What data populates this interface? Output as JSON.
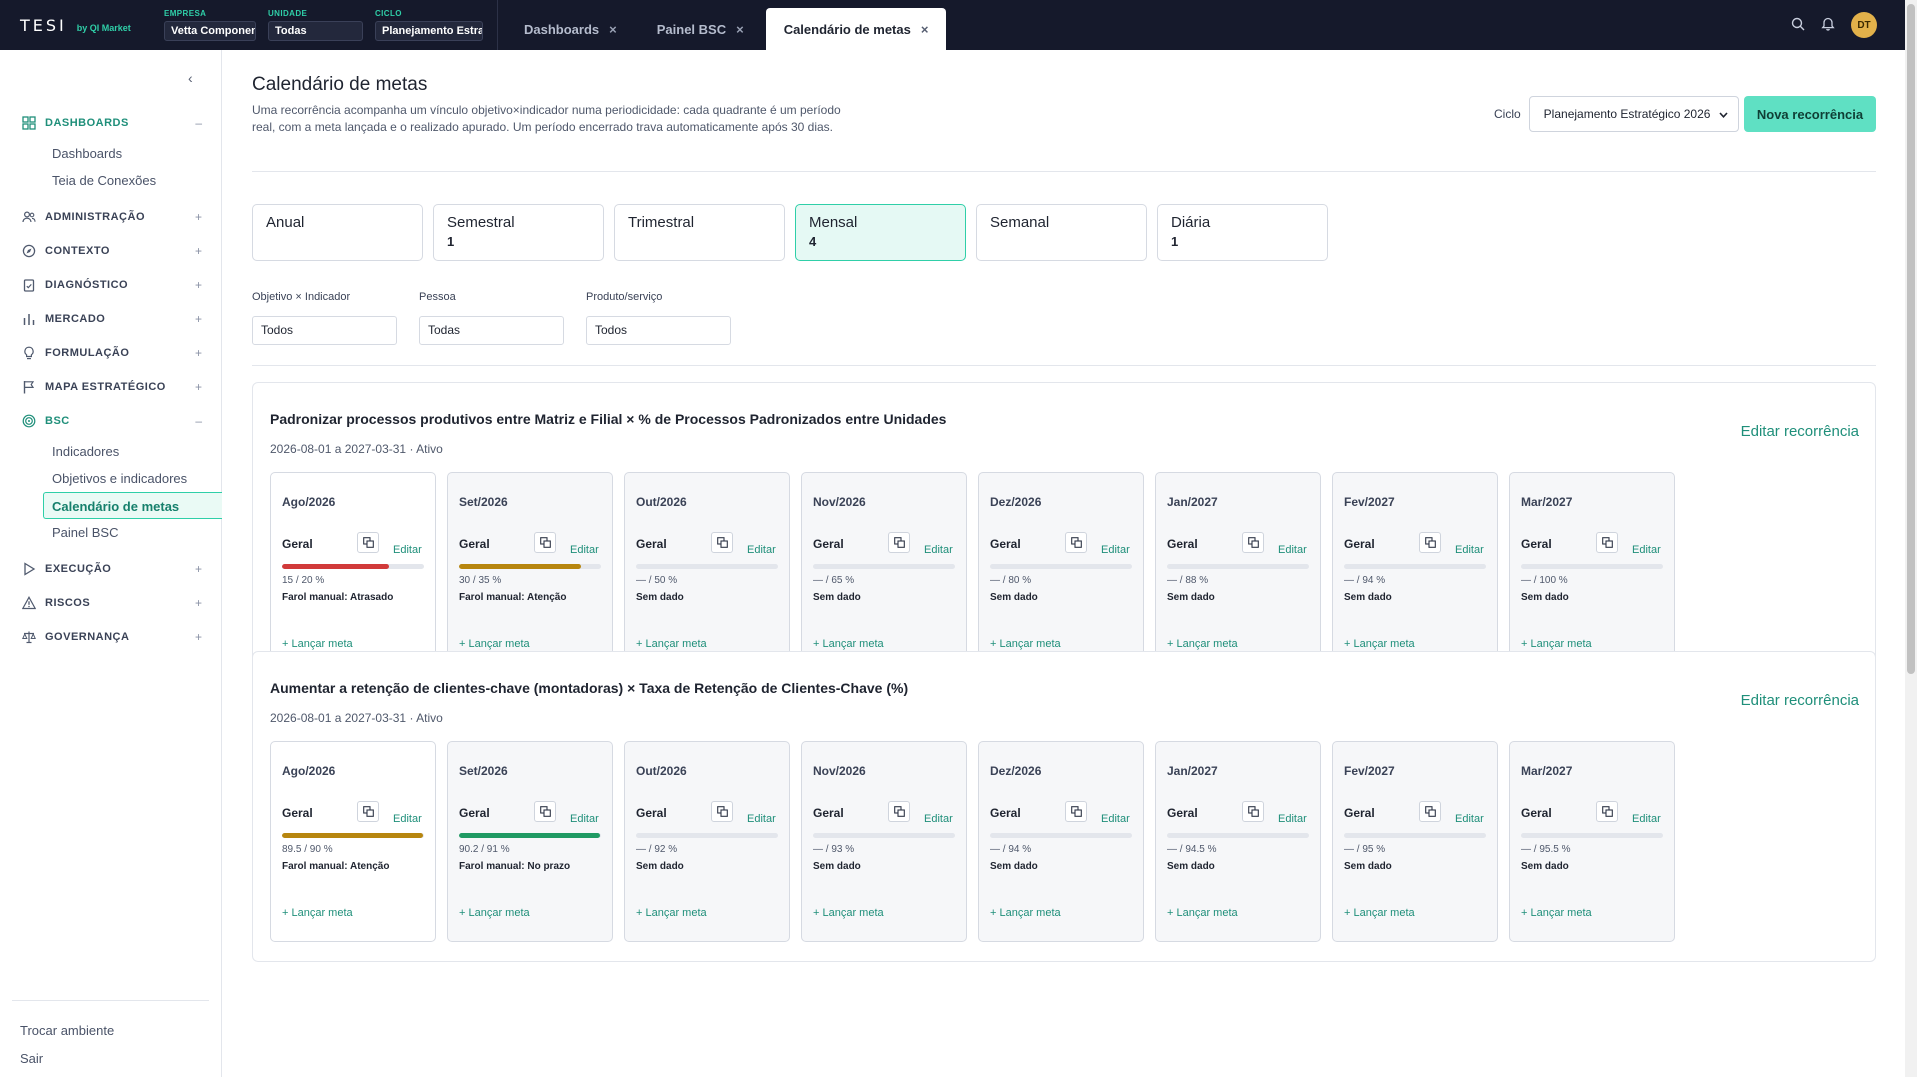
{
  "app": {
    "logo_text": "TESI",
    "logo_by": "by QI Market",
    "context": [
      {
        "label": "EMPRESA",
        "value": "Vetta Componentes"
      },
      {
        "label": "UNIDADE",
        "value": "Todas"
      },
      {
        "label": "CICLO",
        "value": "Planejamento Estratégi"
      }
    ],
    "tabs": [
      {
        "label": "Dashboards",
        "active": false
      },
      {
        "label": "Painel BSC",
        "active": false
      },
      {
        "label": "Calendário de metas",
        "active": true
      }
    ],
    "close_glyph": "×",
    "user_initials": "DT"
  },
  "sidebar": {
    "collapse_glyph": "‹",
    "sections": [
      {
        "title": "DASHBOARDS",
        "icon": "dashboard-icon",
        "open": true,
        "toggle": "–",
        "items": [
          "Dashboards",
          "Teia de Conexões"
        ]
      },
      {
        "title": "ADMINISTRAÇÃO",
        "icon": "users-icon",
        "open": false,
        "toggle": "+"
      },
      {
        "title": "CONTEXTO",
        "icon": "compass-icon",
        "open": false,
        "toggle": "+"
      },
      {
        "title": "DIAGNÓSTICO",
        "icon": "clipboard-icon",
        "open": false,
        "toggle": "+"
      },
      {
        "title": "MERCADO",
        "icon": "bar-chart-icon",
        "open": false,
        "toggle": "+"
      },
      {
        "title": "FORMULAÇÃO",
        "icon": "lightbulb-icon",
        "open": false,
        "toggle": "+"
      },
      {
        "title": "MAPA ESTRATÉGICO",
        "icon": "flag-icon",
        "open": false,
        "toggle": "+"
      },
      {
        "title": "BSC",
        "icon": "target-icon",
        "open": true,
        "toggle": "–",
        "items": [
          "Indicadores",
          "Objetivos e indicadores",
          "Calendário de metas",
          "Painel BSC"
        ],
        "active_item": "Calendário de metas"
      },
      {
        "title": "EXECUÇÃO",
        "icon": "play-icon",
        "open": false,
        "toggle": "+"
      },
      {
        "title": "RISCOS",
        "icon": "warning-icon",
        "open": false,
        "toggle": "+"
      },
      {
        "title": "GOVERNANÇA",
        "icon": "scale-icon",
        "open": false,
        "toggle": "+"
      }
    ],
    "bottom": [
      "Trocar ambiente",
      "Sair"
    ]
  },
  "page": {
    "title": "Calendário de metas",
    "description": "Uma recorrência acompanha um vínculo objetivo×indicador numa periodicidade: cada quadrante é um período real, com a meta lançada e o realizado apurado. Um período encerrado trava automaticamente após 30 dias.",
    "cycle_label": "Ciclo",
    "cycle_value": "Planejamento Estratégico 2026",
    "new_button": "Nova recorrência",
    "periods": [
      {
        "name": "Anual",
        "count": ""
      },
      {
        "name": "Semestral",
        "count": "1"
      },
      {
        "name": "Trimestral",
        "count": ""
      },
      {
        "name": "Mensal",
        "count": "4",
        "active": true
      },
      {
        "name": "Semanal",
        "count": ""
      },
      {
        "name": "Diária",
        "count": "1"
      }
    ],
    "filters": [
      {
        "label": "Objetivo × Indicador",
        "value": "Todos"
      },
      {
        "label": "Pessoa",
        "value": "Todas"
      },
      {
        "label": "Produto/serviço",
        "value": "Todos"
      }
    ]
  },
  "labels": {
    "geral": "Geral",
    "editar": "Editar",
    "lancar": "+ Lançar meta",
    "edit_recurrence": "Editar recorrência"
  },
  "colors": {
    "accent": "#2fcfa8",
    "link": "#1f8f7a",
    "late": "#d13a3a",
    "attention": "#b7860f",
    "on_track": "#1f9a63"
  },
  "recurrences": [
    {
      "title": "Padronizar processos produtivos entre Matriz e Filial × % de Processos Padronizados entre Unidades",
      "subtitle": "2026-08-01 a 2027-03-31 · Ativo",
      "months": [
        {
          "month": "Ago/2026",
          "values": "15 / 20 %",
          "status": "Farol manual: Atrasado",
          "progress": 0.75,
          "color": "#d13a3a"
        },
        {
          "month": "Set/2026",
          "values": "30 / 35 %",
          "status": "Farol manual: Atenção",
          "progress": 0.857,
          "color": "#b7860f"
        },
        {
          "month": "Out/2026",
          "values": "— / 50 %",
          "status": "Sem dado",
          "progress": 0,
          "color": ""
        },
        {
          "month": "Nov/2026",
          "values": "— / 65 %",
          "status": "Sem dado",
          "progress": 0,
          "color": ""
        },
        {
          "month": "Dez/2026",
          "values": "— / 80 %",
          "status": "Sem dado",
          "progress": 0,
          "color": ""
        },
        {
          "month": "Jan/2027",
          "values": "— / 88 %",
          "status": "Sem dado",
          "progress": 0,
          "color": ""
        },
        {
          "month": "Fev/2027",
          "values": "— / 94 %",
          "status": "Sem dado",
          "progress": 0,
          "color": ""
        },
        {
          "month": "Mar/2027",
          "values": "— / 100 %",
          "status": "Sem dado",
          "progress": 0,
          "color": ""
        }
      ]
    },
    {
      "title": "Aumentar a retenção de clientes-chave (montadoras) × Taxa de Retenção de Clientes-Chave (%)",
      "subtitle": "2026-08-01 a 2027-03-31 · Ativo",
      "months": [
        {
          "month": "Ago/2026",
          "values": "89.5 / 90 %",
          "status": "Farol manual: Atenção",
          "progress": 0.994,
          "color": "#b7860f"
        },
        {
          "month": "Set/2026",
          "values": "90.2 / 91 %",
          "status": "Farol manual: No prazo",
          "progress": 0.991,
          "color": "#1f9a63"
        },
        {
          "month": "Out/2026",
          "values": "— / 92 %",
          "status": "Sem dado",
          "progress": 0,
          "color": ""
        },
        {
          "month": "Nov/2026",
          "values": "— / 93 %",
          "status": "Sem dado",
          "progress": 0,
          "color": ""
        },
        {
          "month": "Dez/2026",
          "values": "— / 94 %",
          "status": "Sem dado",
          "progress": 0,
          "color": ""
        },
        {
          "month": "Jan/2027",
          "values": "— / 94.5 %",
          "status": "Sem dado",
          "progress": 0,
          "color": ""
        },
        {
          "month": "Fev/2027",
          "values": "— / 95 %",
          "status": "Sem dado",
          "progress": 0,
          "color": ""
        },
        {
          "month": "Mar/2027",
          "values": "— / 95.5 %",
          "status": "Sem dado",
          "progress": 0,
          "color": ""
        }
      ]
    }
  ]
}
